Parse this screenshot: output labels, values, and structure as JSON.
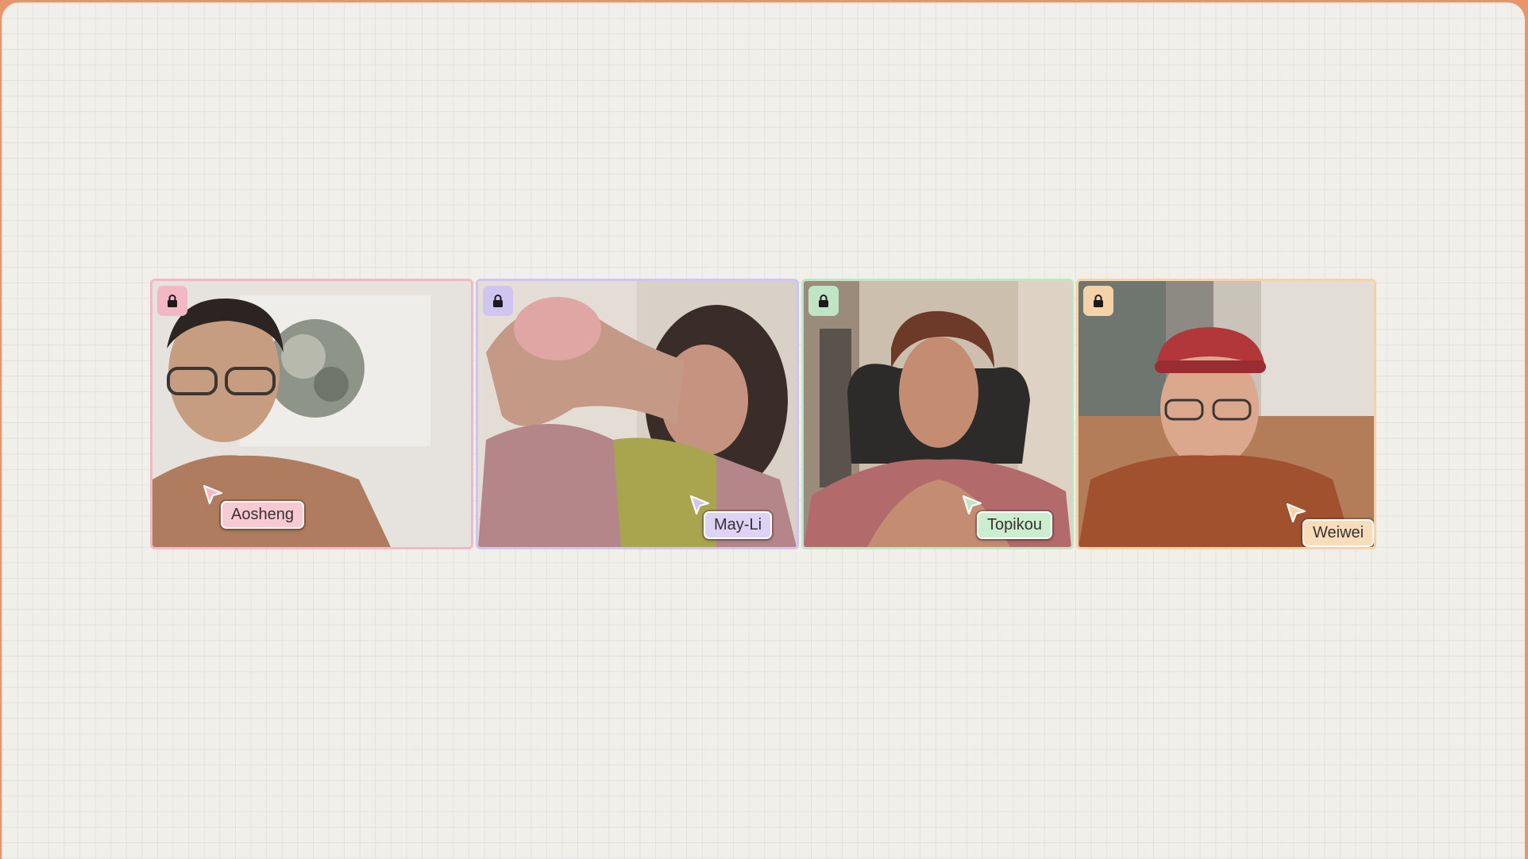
{
  "participants": [
    {
      "name": "Aosheng",
      "accent": "#f2b8c4",
      "tag_bg": "#f7c9d1",
      "icon": "lock-icon",
      "cursor_icon": "pointer-cursor-icon"
    },
    {
      "name": "May-Li",
      "accent": "#cfc5f0",
      "tag_bg": "#ddd3f5",
      "icon": "lock-icon",
      "cursor_icon": "pointer-cursor-icon"
    },
    {
      "name": "Topikou",
      "accent": "#bfe5c5",
      "tag_bg": "#cbeed0",
      "icon": "lock-icon",
      "cursor_icon": "pointer-cursor-icon"
    },
    {
      "name": "Weiwei",
      "accent": "#f5d2a8",
      "tag_bg": "#f8ddbd",
      "icon": "lock-icon",
      "cursor_icon": "pointer-cursor-icon"
    }
  ],
  "colors": {
    "outer_background": "#e8956b",
    "canvas_background": "#f1efea"
  }
}
